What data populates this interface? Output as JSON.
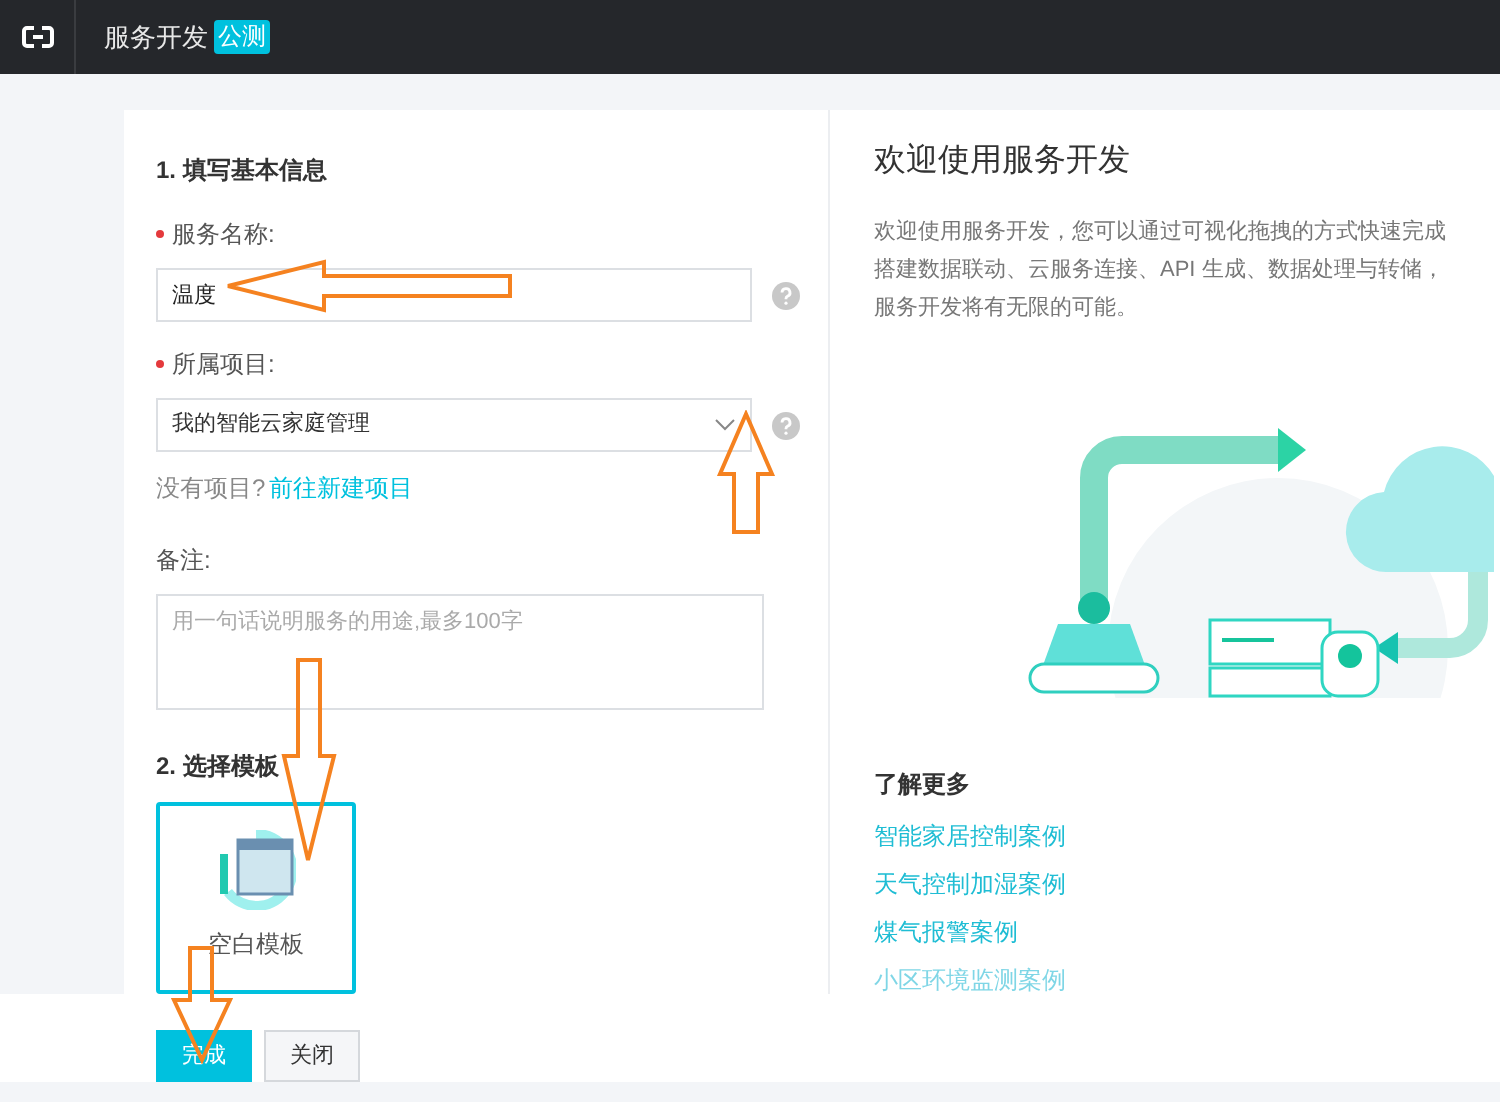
{
  "header": {
    "title": "服务开发",
    "badge": "公测"
  },
  "form": {
    "section_1": "1. 填写基本信息",
    "fields": [
      {
        "kind": "input",
        "label": "服务名称:",
        "required": true,
        "value": "温度"
      },
      {
        "kind": "select",
        "label": "所属项目:",
        "required": true,
        "value": "我的智能云家庭管理"
      }
    ],
    "hint": "没有项目?",
    "hint_link": "前往新建项目",
    "note_label": "备注:",
    "note_placeholder": "用一句话说明服务的用途,最多100字",
    "section_2": "2. 选择模板",
    "templates": [
      {
        "label": "空白模板",
        "selected": true
      }
    ]
  },
  "welcome": {
    "title": "欢迎使用服务开发",
    "lines": [
      "欢迎使用服务开发，您可以通过可视化拖拽的方式快速完成",
      "搭建数据联动、云服务连接、API 生成、数据处理与转储，",
      "服务开发将有无限的可能。"
    ],
    "more_title": "了解更多",
    "links": [
      {
        "label": "智能家居控制案例",
        "faded": false
      },
      {
        "label": "天气控制加湿案例",
        "faded": false
      },
      {
        "label": "煤气报警案例",
        "faded": false
      },
      {
        "label": "小区环境监测案例",
        "faded": true
      }
    ]
  },
  "buttons": [
    {
      "label": "完成",
      "kind": "primary"
    },
    {
      "label": "关闭",
      "kind": "secondary"
    }
  ]
}
